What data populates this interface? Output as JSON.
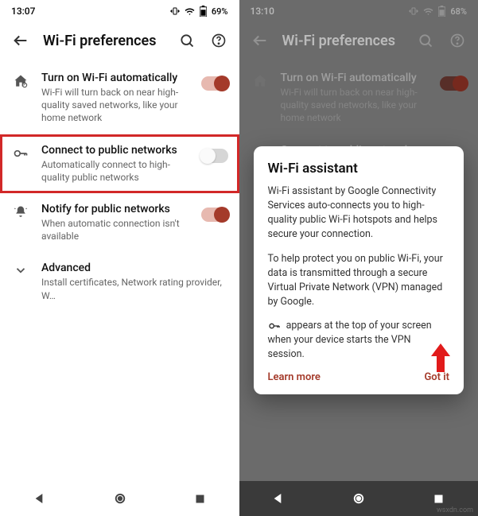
{
  "left": {
    "status": {
      "time": "13:07",
      "battery": "69%"
    },
    "header": {
      "title": "Wi-Fi preferences"
    },
    "rows": [
      {
        "title": "Turn on Wi-Fi automatically",
        "sub": "Wi-Fi will turn back on near high-quality saved networks, like your home network",
        "toggle": "on",
        "icon": "home"
      },
      {
        "title": "Connect to public networks",
        "sub": "Automatically connect to high-quality public networks",
        "toggle": "off",
        "icon": "key",
        "highlight": true
      },
      {
        "title": "Notify for public networks",
        "sub": "When automatic connection isn't available",
        "toggle": "on",
        "icon": "bell"
      },
      {
        "title": "Advanced",
        "sub": "Install certificates, Network rating provider, W…",
        "icon": "chevron"
      }
    ]
  },
  "right": {
    "status": {
      "time": "13:10",
      "battery": "68%"
    },
    "header": {
      "title": "Wi-Fi preferences"
    },
    "rows": [
      {
        "title": "Turn on Wi-Fi automatically",
        "sub": "Wi-Fi will turn back on near high-quality saved networks, like your home network",
        "toggle": "on"
      },
      {
        "title": "Connect to public networks"
      }
    ],
    "dialog": {
      "title": "Wi-Fi assistant",
      "p1": "Wi-Fi assistant by Google Connectivity Services auto-connects you to high-quality public Wi-Fi hotspots and helps secure your connection.",
      "p2": "To help protect you on public Wi-Fi, your data is transmitted through a secure Virtual Private Network (VPN) managed by Google.",
      "p3": "appears at the top of your screen when your device starts the VPN session.",
      "learn": "Learn more",
      "gotit": "Got it"
    }
  },
  "watermark": "wsxdn.com"
}
